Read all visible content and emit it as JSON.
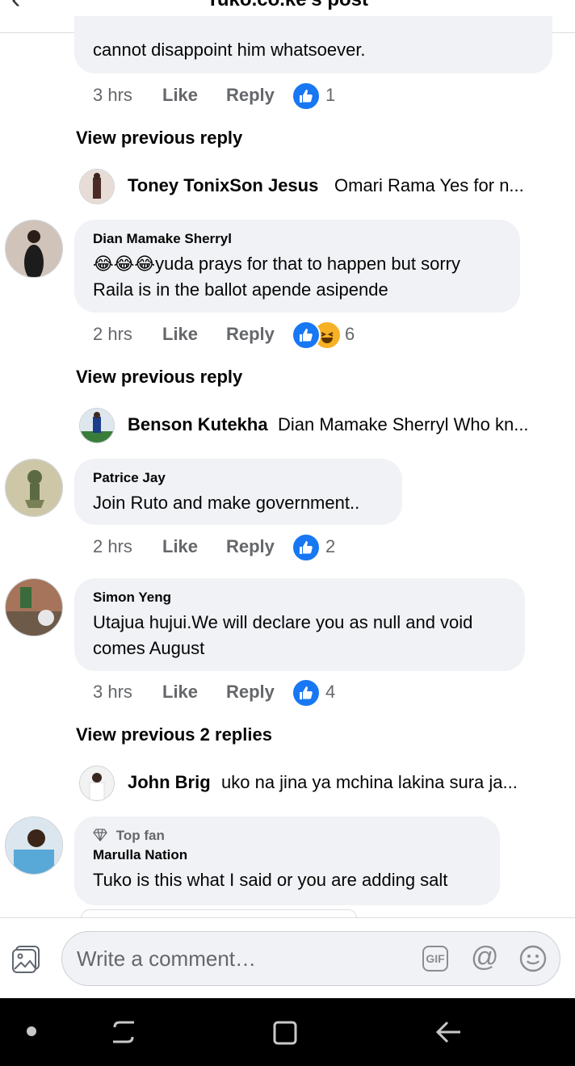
{
  "header": {
    "title": "Tuko.co.ke's post"
  },
  "comments": [
    {
      "text": "cannot disappoint him whatsoever.",
      "time": "3 hrs",
      "like": "Like",
      "reply": "Reply",
      "reactions": [
        "like"
      ],
      "reaction_count": "1"
    },
    {
      "view_previous": "View previous reply",
      "reply_preview": {
        "name": "Toney TonixSon Jesus",
        "text": "Omari Rama Yes for n..."
      }
    },
    {
      "name": "Dian Mamake Sherryl",
      "text_lines": [
        "😂😂😂yuda prays for that to happen but sorry",
        "Raila is in the ballot apende asipende"
      ],
      "time": "2 hrs",
      "like": "Like",
      "reply": "Reply",
      "reactions": [
        "like",
        "haha"
      ],
      "reaction_count": "6"
    },
    {
      "view_previous": "View previous reply",
      "reply_preview": {
        "name": "Benson Kutekha",
        "text": "Dian Mamake Sherryl Who kn..."
      }
    },
    {
      "name": "Patrice Jay",
      "text_lines": [
        "Join Ruto and make government.."
      ],
      "time": "2 hrs",
      "like": "Like",
      "reply": "Reply",
      "reactions": [
        "like"
      ],
      "reaction_count": "2"
    },
    {
      "name": "Simon Yeng",
      "text_lines": [
        "Utajua hujui.We will declare you as null and void",
        "comes August"
      ],
      "time": "3 hrs",
      "like": "Like",
      "reply": "Reply",
      "reactions": [
        "like"
      ],
      "reaction_count": "4"
    },
    {
      "view_previous": "View previous 2 replies",
      "reply_preview": {
        "name": "John Brig",
        "text": "uko na jina ya mchina lakina sura ja..."
      }
    },
    {
      "badge": "Top fan",
      "name": "Marulla Nation",
      "text_lines": [
        "Tuko is this what I said or you are adding salt"
      ]
    }
  ],
  "composer": {
    "placeholder": "Write a comment…",
    "gif_label": "GIF",
    "at_label": "@"
  },
  "colors": {
    "accent": "#1877f2",
    "bubble": "#f0f2f5",
    "muted": "#65676b",
    "navbar": "#000000"
  },
  "icons": [
    "back-arrow-icon",
    "like-reaction-icon",
    "haha-reaction-icon",
    "photo-icon",
    "gif-icon",
    "mention-icon",
    "emoji-icon",
    "diamond-icon",
    "recents-icon",
    "home-icon",
    "back-icon"
  ]
}
